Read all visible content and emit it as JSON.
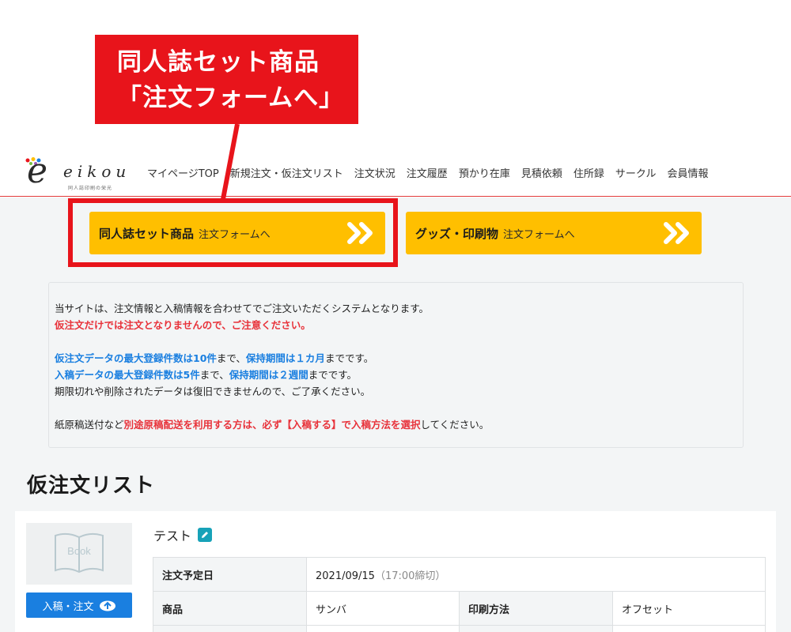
{
  "callout": {
    "line1": "同人誌セット商品",
    "line2": "「注文フォームへ」"
  },
  "logo": {
    "letter": "e",
    "text": "eikou",
    "sub": "同人誌印刷の栄光"
  },
  "nav": [
    "マイページTOP",
    "新規注文・仮注文リスト",
    "注文状況",
    "注文履歴",
    "預かり在庫",
    "見積依頼",
    "住所録",
    "サークル",
    "会員情報"
  ],
  "buttons": {
    "doujin": {
      "strong": "同人誌セット商品",
      "light": "注文フォームへ"
    },
    "goods": {
      "strong": "グッズ・印刷物",
      "light": "注文フォームへ"
    }
  },
  "notice": {
    "l1": "当サイトは、注文情報と入稿情報を合わせてでご注文いただくシステムとなります。",
    "l2": "仮注文だけでは注文となりませんので、ご注意ください。",
    "l3a": "仮注文データの最大登録件数は10件",
    "l3b": "まで、",
    "l3c": "保持期間は１カ月",
    "l3d": "までです。",
    "l4a": "入稿データの最大登録件数は5件",
    "l4b": "まで、",
    "l4c": "保持期間は２週間",
    "l4d": "までです。",
    "l5": "期限切れや削除されたデータは復旧できませんので、ご了承ください。",
    "l6a": "紙原稿送付など",
    "l6b": "別途原稿配送を利用する方は、必ず【入稿する】で入稿方法を選択",
    "l6c": "してください。"
  },
  "list_title": "仮注文リスト",
  "item": {
    "thumb_label": "Book",
    "upload_label": "入稿・注文",
    "name": "テスト",
    "rows": {
      "date_label": "注文予定日",
      "date_value": "2021/09/15",
      "deadline": "（17:00締切）",
      "product_label": "商品",
      "product_value": "サンバ",
      "method_label": "印刷方法",
      "method_value": "オフセット"
    }
  },
  "colors": {
    "accent_yellow": "#ffbf00",
    "alert_red": "#e8141b",
    "link_blue": "#1a7fe0"
  }
}
